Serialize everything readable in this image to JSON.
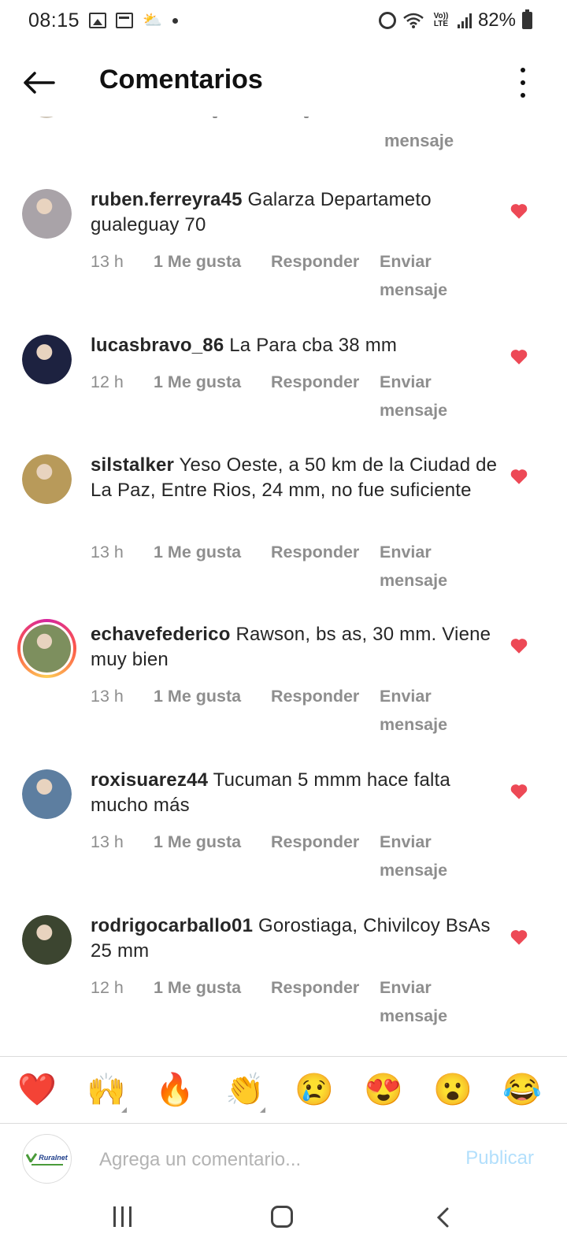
{
  "status_bar": {
    "time": "08:15",
    "battery": "82%",
    "lte_label": "Vo)) LTE"
  },
  "header": {
    "title": "Comentarios",
    "back_icon": "arrow-left-icon",
    "more_icon": "more-vertical-icon"
  },
  "partial_comment": {
    "send_line2": "mensaje"
  },
  "comments": [
    {
      "username": "ruben.ferreyra45",
      "text": "Galarza Departameto gualeguay 70",
      "time": "13 h",
      "likes": "1 Me gusta",
      "reply": "Responder",
      "send_line1": "Enviar",
      "send_line2": "mensaje",
      "liked": true,
      "avatar_color": "#a9a3a8"
    },
    {
      "username": "lucasbravo_86",
      "text": "La Para cba 38 mm",
      "time": "12 h",
      "likes": "1 Me gusta",
      "reply": "Responder",
      "send_line1": "Enviar",
      "send_line2": "mensaje",
      "liked": true,
      "avatar_color": "#1d2240"
    },
    {
      "username": "silstalker",
      "text": "Yeso Oeste, a 50 km de la Ciudad de La Paz, Entre Rios, 24 mm, no fue suficiente",
      "time": "13 h",
      "likes": "1 Me gusta",
      "reply": "Responder",
      "send_line1": "Enviar",
      "send_line2": "mensaje",
      "liked": true,
      "avatar_color": "#b89a5a"
    },
    {
      "username": "echavefederico",
      "text": "Rawson, bs as, 30 mm. Viene muy bien",
      "time": "13 h",
      "likes": "1 Me gusta",
      "reply": "Responder",
      "send_line1": "Enviar",
      "send_line2": "mensaje",
      "liked": true,
      "avatar_color": "#7d8f5e"
    },
    {
      "username": "roxisuarez44",
      "text": "Tucuman 5 mmm hace falta mucho más",
      "time": "13 h",
      "likes": "1 Me gusta",
      "reply": "Responder",
      "send_line1": "Enviar",
      "send_line2": "mensaje",
      "liked": true,
      "avatar_color": "#5d7ea0"
    },
    {
      "username": "rodrigocarballo01",
      "text": "Gorostiaga, Chivilcoy BsAs 25 mm",
      "time": "12 h",
      "likes": "1 Me gusta",
      "reply": "Responder",
      "send_line1": "Enviar",
      "send_line2": "mensaje",
      "liked": true,
      "avatar_color": "#3c4530"
    }
  ],
  "emoji_bar": [
    "❤️",
    "🙌",
    "🔥",
    "👏",
    "😢",
    "😍",
    "😮",
    "😂"
  ],
  "input": {
    "placeholder": "Agrega un comentario...",
    "publish_label": "Publicar",
    "own_logo_text": "Ruralnet"
  },
  "colors": {
    "heart": "#ed4956",
    "muted": "#8e8e8e",
    "publish_disabled": "#b2dffc"
  }
}
